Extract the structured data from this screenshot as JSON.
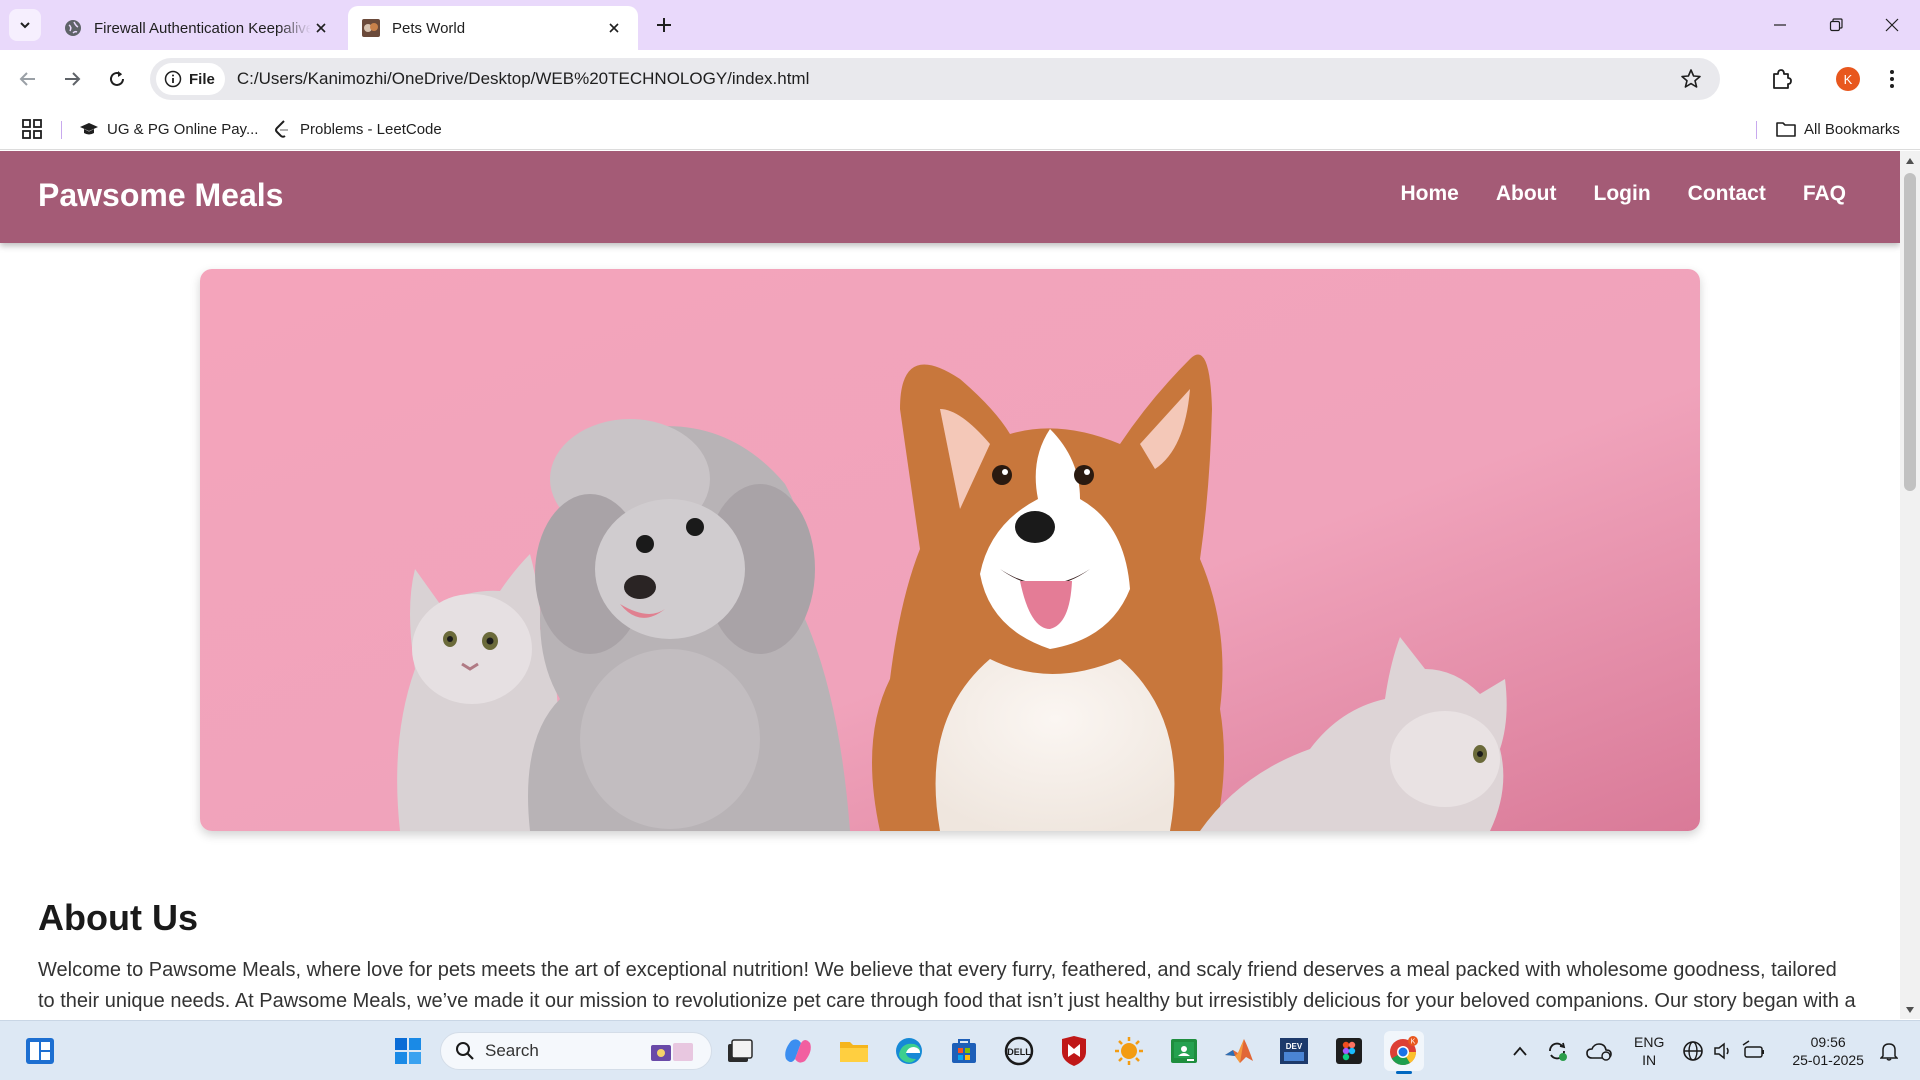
{
  "browser": {
    "tabs": [
      {
        "title": "Firewall Authentication Keepalive",
        "active": false
      },
      {
        "title": "Pets World",
        "active": true
      }
    ],
    "address": {
      "chip_label": "File",
      "url": "C:/Users/Kanimozhi/OneDrive/Desktop/WEB%20TECHNOLOGY/index.html"
    },
    "profile_initial": "K",
    "bookmarks": [
      {
        "label": "UG & PG Online Pay...",
        "icon": "graduation-cap-icon"
      },
      {
        "label": "Problems - LeetCode",
        "icon": "leetcode-icon"
      }
    ],
    "all_bookmarks_label": "All Bookmarks"
  },
  "site": {
    "logo": "Pawsome Meals",
    "nav": [
      "Home",
      "About",
      "Login",
      "Contact",
      "FAQ"
    ],
    "header_color": "#a45b76",
    "hero_background": "#f2a7bd",
    "about": {
      "title": "About Us",
      "text": "Welcome to Pawsome Meals, where love for pets meets the art of exceptional nutrition! We believe that every furry, feathered, and scaly friend deserves a meal packed with wholesome goodness, tailored to their unique needs. At Pawsome Meals, we’ve made it our mission to revolutionize pet care through food that isn’t just healthy but irresistibly delicious for your beloved companions. Our story began with a"
    }
  },
  "taskbar": {
    "search_label": "Search",
    "apps": [
      "widgets-icon",
      "windows-start-icon",
      "search-icon",
      "file-explorer-task-icon",
      "copilot-icon",
      "folder-icon",
      "edge-icon",
      "store-icon",
      "dell-icon",
      "mcafee-icon",
      "weather-icon",
      "classroom-icon",
      "matlab-icon",
      "devc-icon",
      "figma-icon",
      "chrome-icon"
    ],
    "language": {
      "line1": "ENG",
      "line2": "IN"
    },
    "time": "09:56",
    "date": "25-01-2025"
  }
}
